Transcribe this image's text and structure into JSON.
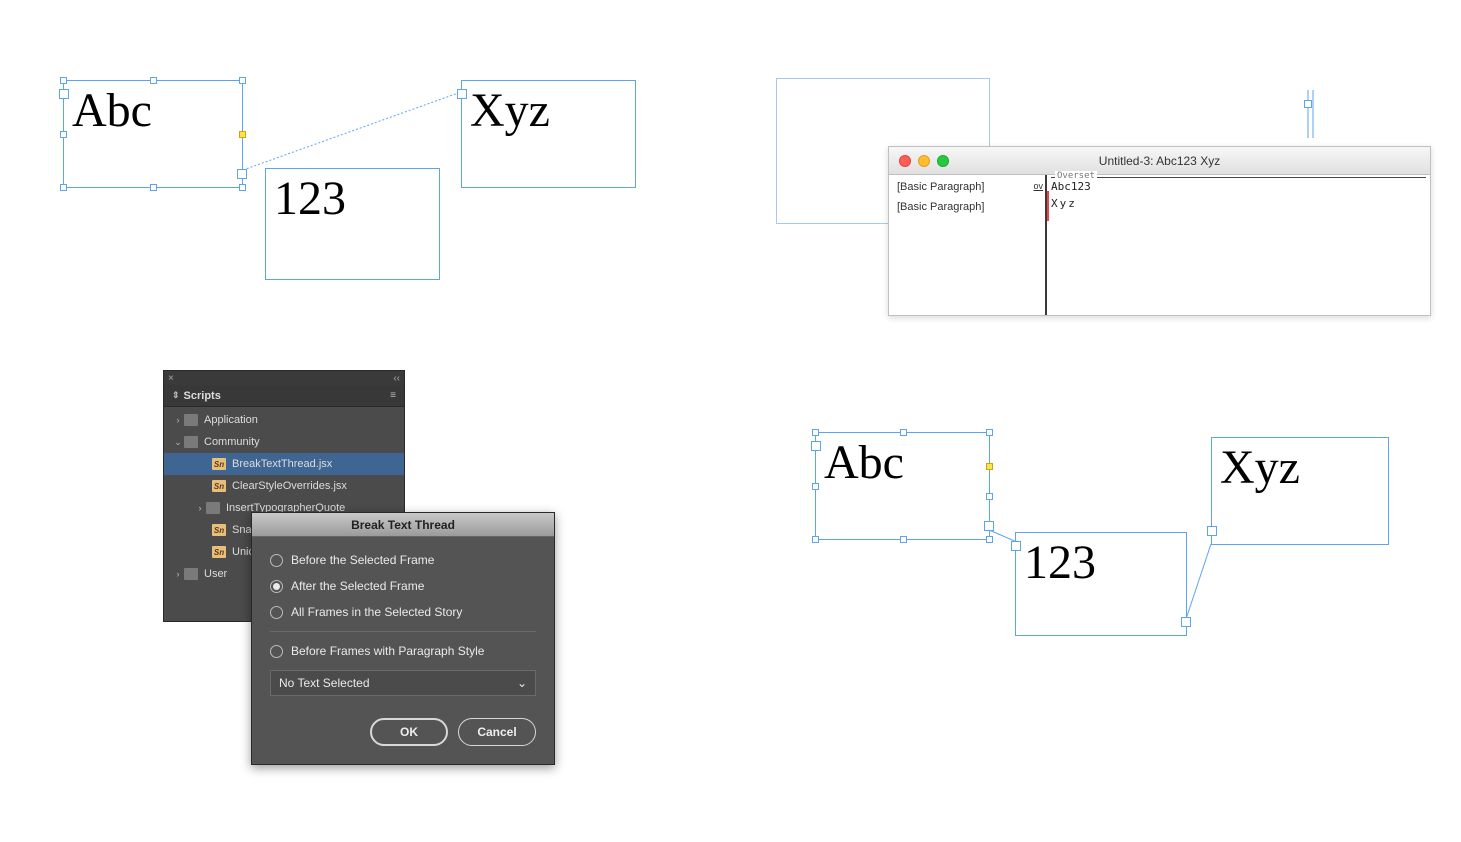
{
  "q1": {
    "frame_a_text": "Abc",
    "frame_b_text": "123",
    "frame_c_text": "Xyz"
  },
  "q2": {
    "window_title": "Untitled-3: Abc123 Xyz",
    "para_style_1": "[Basic Paragraph]",
    "para_style_2": "[Basic Paragraph]",
    "ov_label": "ov",
    "overset_label": "Overset",
    "line1": "Abc123",
    "line2": "Xyz"
  },
  "q3": {
    "panel_title": "Scripts",
    "close_glyph": "×",
    "collapse_glyph": "‹‹",
    "menu_glyph": "≡",
    "folders": {
      "application": "Application",
      "community": "Community",
      "user": "User"
    },
    "scripts": [
      "BreakTextThread.jsx",
      "ClearStyleOverrides.jsx",
      "InsertTypographerQuote",
      "Snap",
      "Unicc"
    ],
    "dialog": {
      "title": "Break Text Thread",
      "option1": "Before the Selected Frame",
      "option2": "After the Selected Frame",
      "option3": "All Frames in the Selected Story",
      "option4": "Before Frames with Paragraph Style",
      "dropdown": "No Text Selected",
      "ok": "OK",
      "cancel": "Cancel"
    }
  },
  "q4": {
    "frame_a_text": "Abc",
    "frame_b_text": "123",
    "frame_c_text": "Xyz"
  }
}
